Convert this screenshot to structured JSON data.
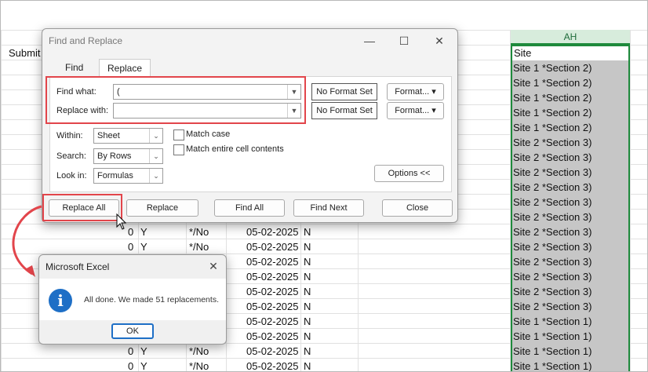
{
  "sheet": {
    "column_header": "AH",
    "partial_header": "Submit",
    "site_header": "Site",
    "site_values": [
      "Site 1 *Section 2)",
      "Site 1 *Section 2)",
      "Site 1 *Section 2)",
      "Site 1 *Section 2)",
      "Site 1 *Section 2)",
      "Site 2 *Section 3)",
      "Site 2 *Section 3)",
      "Site 2 *Section 3)",
      "Site 2 *Section 3)",
      "Site 2 *Section 3)",
      "Site 2 *Section 3)",
      "Site 2 *Section 3)",
      "Site 2 *Section 3)",
      "Site 2 *Section 3)",
      "Site 2 *Section 3)",
      "Site 2 *Section 3)",
      "Site 2 *Section 3)",
      "Site 1 *Section 1)",
      "Site 1 *Section 1)",
      "Site 1 *Section 1)",
      "Site 1 *Section 1)"
    ],
    "data_rows": [
      {
        "num": "0",
        "flag": "Y",
        "tag": "*/No",
        "date": "05-02-2025",
        "n": "N"
      },
      {
        "num": "0",
        "flag": "Y",
        "tag": "*/No",
        "date": "05-02-2025",
        "n": "N"
      },
      {
        "num": "",
        "flag": "",
        "tag": "",
        "date": "05-02-2025",
        "n": "N"
      },
      {
        "num": "",
        "flag": "",
        "tag": "",
        "date": "05-02-2025",
        "n": "N"
      },
      {
        "num": "",
        "flag": "",
        "tag": "",
        "date": "05-02-2025",
        "n": "N"
      },
      {
        "num": "",
        "flag": "",
        "tag": "",
        "date": "05-02-2025",
        "n": "N"
      },
      {
        "num": "",
        "flag": "",
        "tag": "",
        "date": "05-02-2025",
        "n": "N"
      },
      {
        "num": "",
        "flag": "",
        "tag": "",
        "date": "05-02-2025",
        "n": "N"
      },
      {
        "num": "0",
        "flag": "Y",
        "tag": "*/No",
        "date": "05-02-2025",
        "n": "N"
      },
      {
        "num": "0",
        "flag": "Y",
        "tag": "*/No",
        "date": "05-02-2025",
        "n": "N"
      }
    ]
  },
  "find_replace": {
    "title": "Find and Replace",
    "tabs": [
      "Find",
      "Replace"
    ],
    "find_label": "Find what:",
    "find_value": "(",
    "replace_label": "Replace with:",
    "replace_value": "",
    "no_format_1": "No Format Set",
    "no_format_2": "No Format Set",
    "format_1": "Format...",
    "format_2": "Format...",
    "within_label": "Within:",
    "within_value": "Sheet",
    "search_label": "Search:",
    "search_value": "By Rows",
    "lookin_label": "Look in:",
    "lookin_value": "Formulas",
    "match_case": "Match case",
    "match_entire": "Match entire cell contents",
    "options": "Options <<",
    "replace_all": "Replace All",
    "replace": "Replace",
    "find_all": "Find All",
    "find_next": "Find Next",
    "close": "Close"
  },
  "message": {
    "title": "Microsoft Excel",
    "text": "All done. We made 51 replacements.",
    "ok": "OK",
    "icon": "info-icon"
  },
  "colors": {
    "accent_red": "#e2454b",
    "excel_green": "#1e8a3c",
    "info_blue": "#1e6fc6"
  }
}
